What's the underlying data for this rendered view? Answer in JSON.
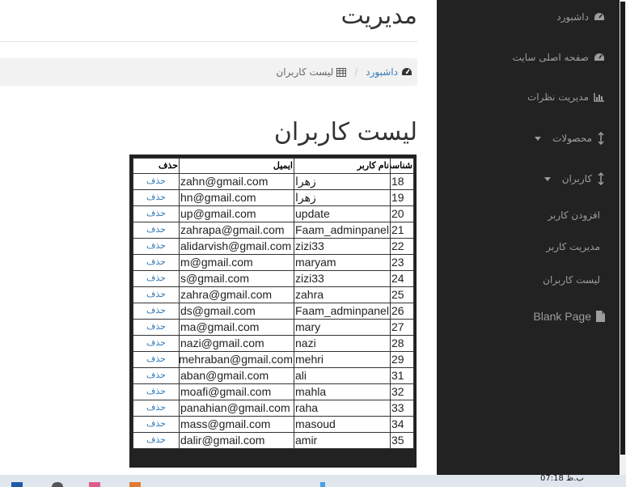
{
  "page": {
    "title": "مدیریت",
    "breadcrumb": {
      "home": "داشبورد",
      "separator": "/",
      "current": "لیست کاربران"
    },
    "list_title": "لیست کاربران"
  },
  "table": {
    "headers": {
      "id": "شناسه",
      "username": "نام کاربر",
      "email": "ایمیل",
      "delete": "حذف"
    },
    "rows": [
      {
        "id": "18",
        "username": "زهرا",
        "email": "zahn@gmail.com",
        "delete": "حذف"
      },
      {
        "id": "19",
        "username": "زهرا",
        "email": "hn@gmail.com",
        "delete": "حذف"
      },
      {
        "id": "20",
        "username": "update",
        "email": "up@gmail.com",
        "delete": "حذف"
      },
      {
        "id": "21",
        "username": "Faam_adminpanel",
        "email": "zahrapa@gmail.com",
        "delete": "حذف"
      },
      {
        "id": "22",
        "username": "zizi33",
        "email": "alidarvish@gmail.com",
        "delete": "حذف"
      },
      {
        "id": "23",
        "username": "maryam",
        "email": "m@gmail.com",
        "delete": "حذف"
      },
      {
        "id": "24",
        "username": "zizi33",
        "email": "s@gmail.com",
        "delete": "حذف"
      },
      {
        "id": "25",
        "username": "zahra",
        "email": "zahra@gmail.com",
        "delete": "حذف"
      },
      {
        "id": "26",
        "username": "Faam_adminpanel",
        "email": "ds@gmail.com",
        "delete": "حذف"
      },
      {
        "id": "27",
        "username": "mary",
        "email": "ma@gmail.com",
        "delete": "حذف"
      },
      {
        "id": "28",
        "username": "nazi",
        "email": "nazi@gmail.com",
        "delete": "حذف"
      },
      {
        "id": "29",
        "username": "mehri",
        "email": "mehraban@gmail.com",
        "delete": "حذف"
      },
      {
        "id": "31",
        "username": "ali",
        "email": "aban@gmail.com",
        "delete": "حذف"
      },
      {
        "id": "32",
        "username": "mahla",
        "email": "moafi@gmail.com",
        "delete": "حذف"
      },
      {
        "id": "33",
        "username": "raha",
        "email": "panahian@gmail.com",
        "delete": "حذف"
      },
      {
        "id": "34",
        "username": "masoud",
        "email": "mass@gmail.com",
        "delete": "حذف"
      },
      {
        "id": "35",
        "username": "amir",
        "email": "dalir@gmail.com",
        "delete": "حذف"
      }
    ]
  },
  "sidebar": {
    "items": [
      {
        "label": "داشبورد",
        "icon": "dashboard-icon"
      },
      {
        "label": "صفحه اصلی سایت",
        "icon": "dashboard-icon"
      },
      {
        "label": "مدیریت نظرات",
        "icon": "bar-chart-icon"
      },
      {
        "label": "محصولات",
        "icon": "sort-icon"
      },
      {
        "label": "کاربران",
        "icon": "sort-icon"
      },
      {
        "label": "افزودن کاربر"
      },
      {
        "label": "مدیریت کاربر"
      },
      {
        "label": "لیست کاربران"
      },
      {
        "label": "Blank Page",
        "icon": "file-icon"
      }
    ]
  },
  "taskbar": {
    "clock": "07:18 ب.ظ"
  },
  "colors": {
    "sidebar_bg": "#222222",
    "link": "#337ab7",
    "breadcrumb_bg": "#f2f2f2"
  }
}
